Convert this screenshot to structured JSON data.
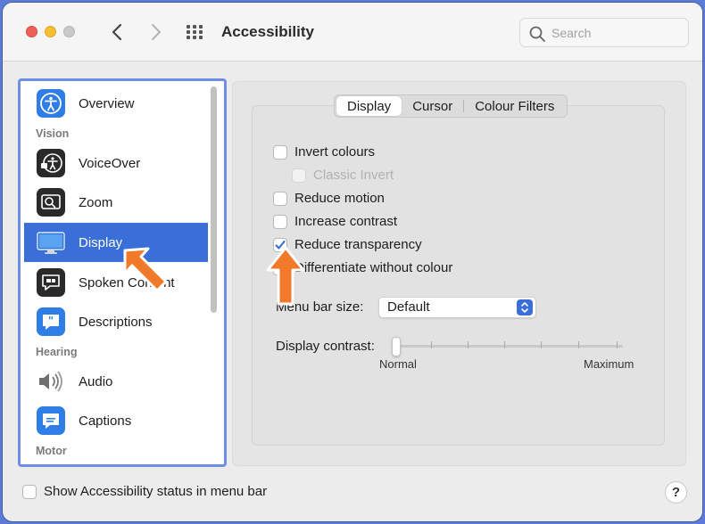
{
  "window": {
    "title": "Accessibility"
  },
  "search": {
    "placeholder": "Search"
  },
  "sidebar": {
    "items": [
      {
        "label": "Overview",
        "icon": "accessibility-icon"
      },
      {
        "label": "VoiceOver",
        "icon": "voiceover-icon"
      },
      {
        "label": "Zoom",
        "icon": "zoom-icon"
      },
      {
        "label": "Display",
        "icon": "display-icon",
        "selected": true
      },
      {
        "label": "Spoken Content",
        "icon": "spoken-content-icon"
      },
      {
        "label": "Descriptions",
        "icon": "descriptions-icon"
      },
      {
        "label": "Audio",
        "icon": "speaker-icon"
      },
      {
        "label": "Captions",
        "icon": "captions-icon"
      }
    ],
    "headers": {
      "vision": "Vision",
      "hearing": "Hearing",
      "motor": "Motor"
    }
  },
  "tabs": [
    {
      "label": "Display",
      "active": true
    },
    {
      "label": "Cursor",
      "active": false
    },
    {
      "label": "Colour Filters",
      "active": false
    }
  ],
  "options": {
    "invert_colours": {
      "label": "Invert colours",
      "checked": false
    },
    "classic_invert": {
      "label": "Classic Invert",
      "checked": false,
      "disabled": true
    },
    "reduce_motion": {
      "label": "Reduce motion",
      "checked": false
    },
    "increase_contrast": {
      "label": "Increase contrast",
      "checked": false
    },
    "reduce_transparency": {
      "label": "Reduce transparency",
      "checked": true
    },
    "differentiate": {
      "label": "Differentiate without colour",
      "checked": false
    }
  },
  "menu_bar_size": {
    "label": "Menu bar size:",
    "value": "Default"
  },
  "display_contrast": {
    "label": "Display contrast:",
    "min_label": "Normal",
    "max_label": "Maximum",
    "value": 0
  },
  "footer": {
    "status_checkbox_label": "Show Accessibility status in menu bar",
    "status_checked": false,
    "help_label": "?"
  },
  "colors": {
    "selection": "#3b6fd8",
    "annotation_arrow": "#f07a2a",
    "sidebar_border": "#6f8fe6"
  }
}
